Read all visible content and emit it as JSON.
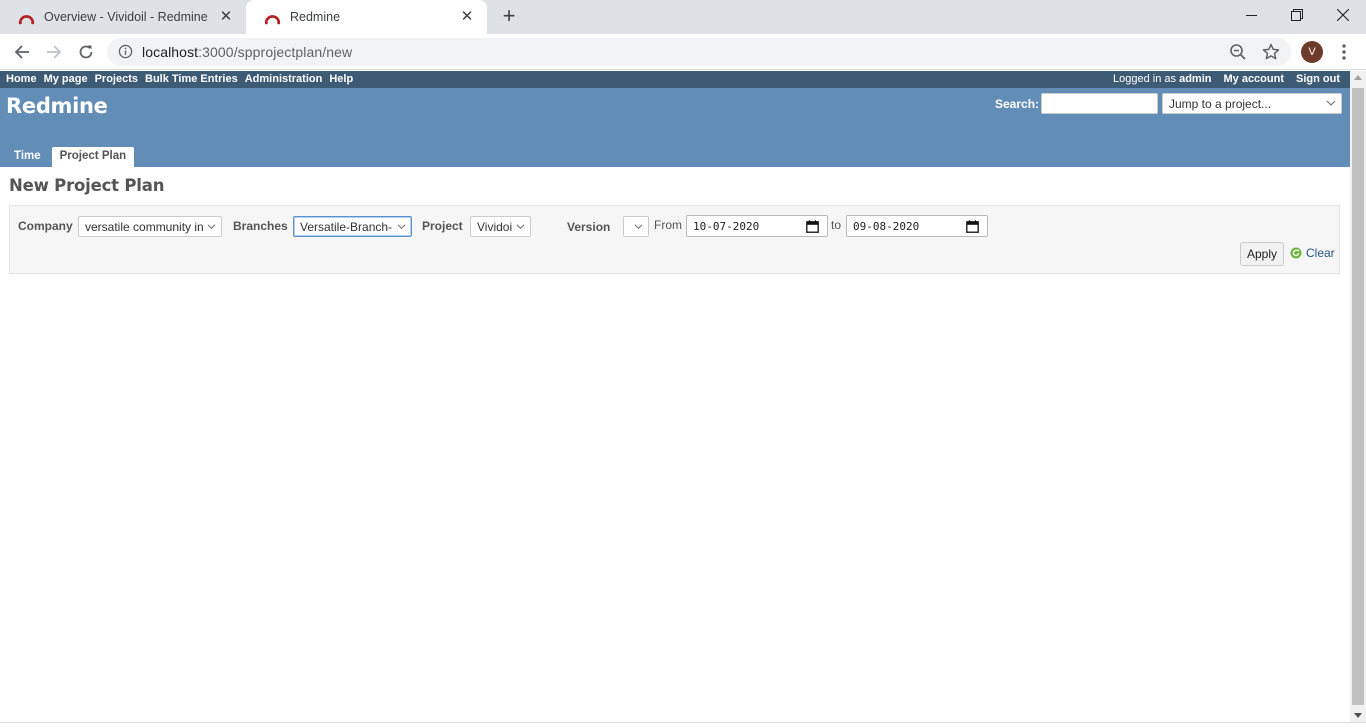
{
  "browser": {
    "tabs": [
      {
        "title": "Overview - Vividoil - Redmine",
        "active": false
      },
      {
        "title": "Redmine",
        "active": true
      }
    ],
    "url_host": "localhost",
    "url_path": ":3000/spprojectplan/new",
    "profile_initial": "V",
    "icons": {
      "favicon": "redmine-favicon-icon",
      "close": "close-icon",
      "new_tab": "plus-icon",
      "back": "arrow-left-icon",
      "forward": "arrow-right-icon",
      "reload": "reload-icon",
      "info": "info-icon",
      "zoom": "zoom-icon",
      "bookmark": "star-icon",
      "menu": "kebab-menu-icon"
    }
  },
  "topmenu": {
    "items": [
      "Home",
      "My page",
      "Projects",
      "Bulk Time Entries",
      "Administration",
      "Help"
    ],
    "logged_prefix": "Logged in as",
    "logged_user": "admin",
    "my_account": "My account",
    "sign_out": "Sign out"
  },
  "header": {
    "title": "Redmine",
    "search_label": "Search:",
    "search_value": "",
    "jump_placeholder": "Jump to a project...",
    "tabs": [
      {
        "label": "Time",
        "selected": false
      },
      {
        "label": "Project Plan",
        "selected": true
      }
    ]
  },
  "content": {
    "heading": "New Project Plan",
    "filters": {
      "company_label": "Company",
      "company_value": "versatile community in",
      "branches_label": "Branches",
      "branches_value": "Versatile-Branch-",
      "project_label": "Project",
      "project_value": "Vividoi",
      "version_label": "Version",
      "version_value": "",
      "from_label": "From",
      "from_date": "10-07-2020",
      "to_label": "to",
      "to_date": "09-08-2020",
      "apply_label": "Apply",
      "clear_label": "Clear"
    }
  },
  "colors": {
    "topmenu_bg": "#3e5b76",
    "header_bg": "#628db6",
    "link": "#2a5685"
  }
}
